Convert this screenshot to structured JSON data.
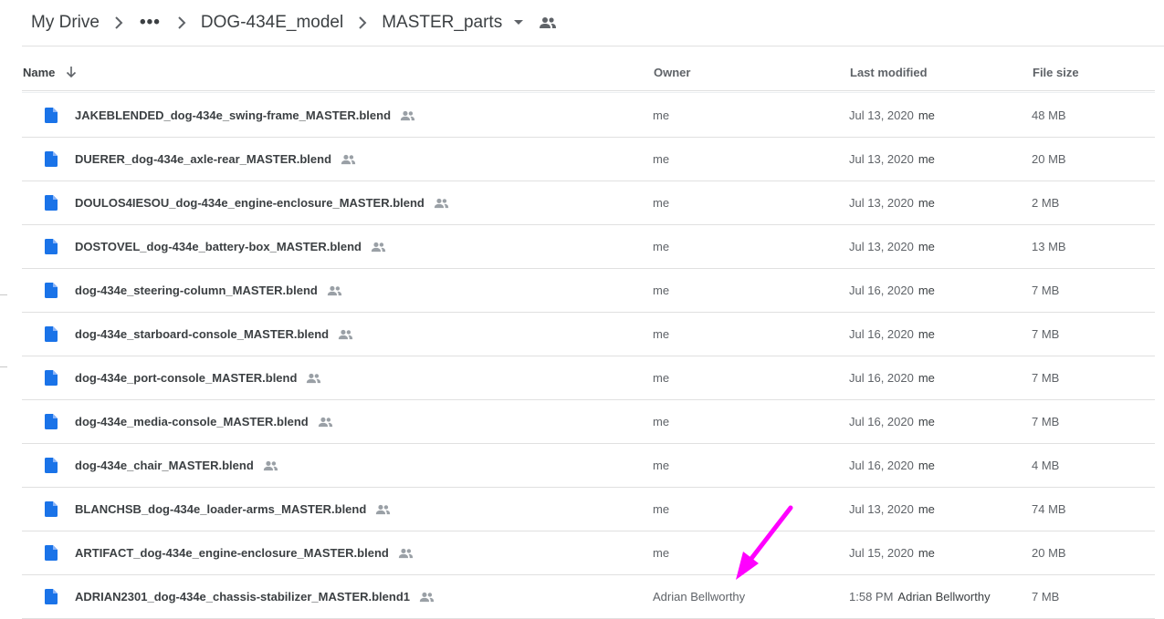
{
  "breadcrumb": {
    "items": [
      "My Drive",
      "•••",
      "DOG-434E_model",
      "MASTER_parts"
    ],
    "icons": {
      "separator": "chevron-right-icon",
      "caret": "caret-down-icon",
      "shared": "people-icon"
    }
  },
  "header": {
    "name": "Name",
    "owner": "Owner",
    "modified": "Last modified",
    "size": "File size",
    "sort_icon": "arrow-down-icon"
  },
  "files": [
    {
      "name": "JAKEBLENDED_dog-434e_swing-frame_MASTER.blend",
      "owner": "me",
      "modified": "Jul 13, 2020",
      "modifier": "me",
      "size": "48 MB"
    },
    {
      "name": "DUERER_dog-434e_axle-rear_MASTER.blend",
      "owner": "me",
      "modified": "Jul 13, 2020",
      "modifier": "me",
      "size": "20 MB"
    },
    {
      "name": "DOULOS4IESOU_dog-434e_engine-enclosure_MASTER.blend",
      "owner": "me",
      "modified": "Jul 13, 2020",
      "modifier": "me",
      "size": "2 MB"
    },
    {
      "name": "DOSTOVEL_dog-434e_battery-box_MASTER.blend",
      "owner": "me",
      "modified": "Jul 13, 2020",
      "modifier": "me",
      "size": "13 MB"
    },
    {
      "name": "dog-434e_steering-column_MASTER.blend",
      "owner": "me",
      "modified": "Jul 16, 2020",
      "modifier": "me",
      "size": "7 MB"
    },
    {
      "name": "dog-434e_starboard-console_MASTER.blend",
      "owner": "me",
      "modified": "Jul 16, 2020",
      "modifier": "me",
      "size": "7 MB"
    },
    {
      "name": "dog-434e_port-console_MASTER.blend",
      "owner": "me",
      "modified": "Jul 16, 2020",
      "modifier": "me",
      "size": "7 MB"
    },
    {
      "name": "dog-434e_media-console_MASTER.blend",
      "owner": "me",
      "modified": "Jul 16, 2020",
      "modifier": "me",
      "size": "7 MB"
    },
    {
      "name": "dog-434e_chair_MASTER.blend",
      "owner": "me",
      "modified": "Jul 16, 2020",
      "modifier": "me",
      "size": "4 MB"
    },
    {
      "name": "BLANCHSB_dog-434e_loader-arms_MASTER.blend",
      "owner": "me",
      "modified": "Jul 13, 2020",
      "modifier": "me",
      "size": "74 MB"
    },
    {
      "name": "ARTIFACT_dog-434e_engine-enclosure_MASTER.blend",
      "owner": "me",
      "modified": "Jul 15, 2020",
      "modifier": "me",
      "size": "20 MB"
    },
    {
      "name": "ADRIAN2301_dog-434e_chassis-stabilizer_MASTER.blend1",
      "owner": "Adrian Bellworthy",
      "modified": "1:58 PM",
      "modifier": "Adrian Bellworthy",
      "size": "7 MB"
    }
  ],
  "colors": {
    "file_icon": "#1a73e8",
    "annotation_arrow": "#ff00ff",
    "divider": "#e0e0e0"
  },
  "annotation": {
    "type": "arrow",
    "icon": "pointer-arrow-icon"
  }
}
